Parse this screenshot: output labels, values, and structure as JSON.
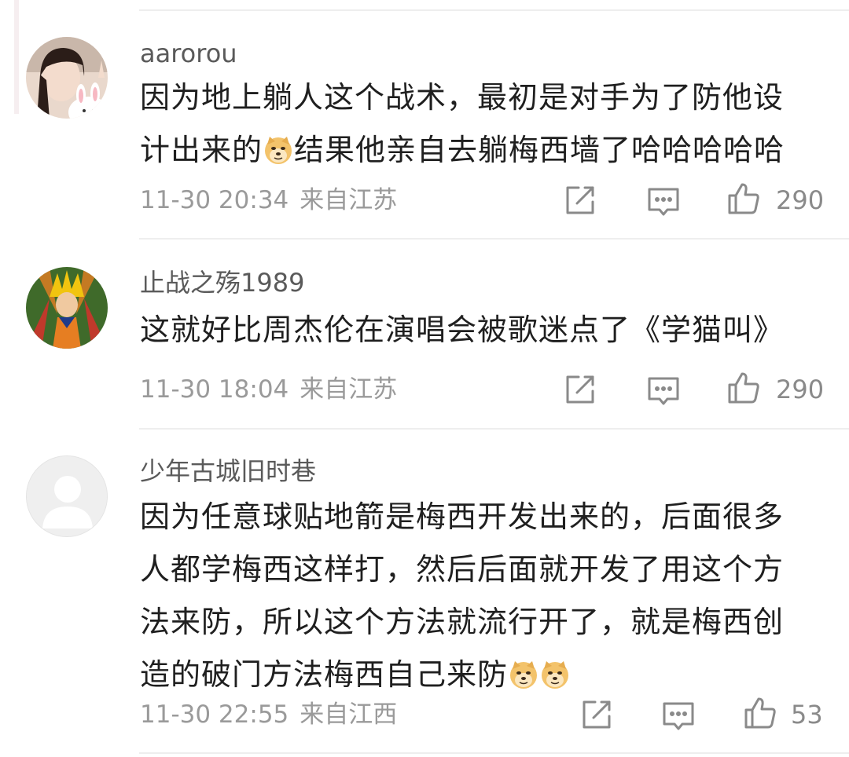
{
  "comments": [
    {
      "username": "aarorou",
      "text_1": "因为地上躺人这个战术，最初是对手为了防他设",
      "text_2a": "计出来的",
      "text_2b": "结果他亲自去躺梅西墙了哈哈哈哈哈",
      "time": "11-30 20:34",
      "location": "来自江苏",
      "likes": "290",
      "emojis": [
        "doge-emoji"
      ]
    },
    {
      "username": "止战之殇1989",
      "text_1": "这就好比周杰伦在演唱会被歌迷点了《学猫叫》",
      "time": "11-30 18:04",
      "location": "来自江苏",
      "likes": "290"
    },
    {
      "username": "少年古城旧时巷",
      "text_1": "因为任意球贴地箭是梅西开发出来的，后面很多",
      "text_2": "人都学梅西这样打，然后后面就开发了用这个方",
      "text_3": "法来防，所以这个方法就流行开了，就是梅西创",
      "text_4": "造的破门方法梅西自己来防",
      "time": "11-30 22:55",
      "location": "来自江西",
      "likes": "53",
      "emojis": [
        "doge-emoji",
        "doge-emoji"
      ]
    }
  ],
  "icons": {
    "share": "share-icon",
    "comment": "comment-icon",
    "like": "thumbs-up-icon"
  },
  "colors": {
    "text": "#1f1f1f",
    "username": "#5a5a5a",
    "meta": "#9a9a9a",
    "divider": "#eeeeee"
  }
}
